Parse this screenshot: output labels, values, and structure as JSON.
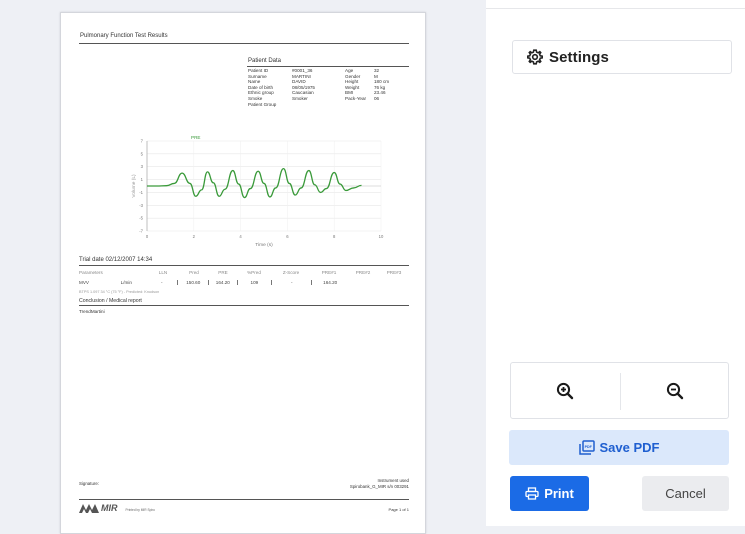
{
  "report": {
    "title": "Pulmonary Function Test Results",
    "patient_data_heading": "Patient Data",
    "patient_rows": [
      [
        "Patient ID",
        "#0001_36",
        "Age",
        "32"
      ],
      [
        "Surname",
        "MARTINI",
        "Gender",
        "M"
      ],
      [
        "Name",
        "DAVID",
        "Height",
        "180 cm"
      ],
      [
        "Date of birth",
        "08/05/1975",
        "Weight",
        "76 kg"
      ],
      [
        "Ethnic group",
        "Caucasian",
        "BMI",
        "23.46"
      ],
      [
        "Smoke",
        "Smoker",
        "Pack-Year",
        "06"
      ],
      [
        "Patient Group",
        "",
        "",
        ""
      ]
    ],
    "trial_date": "Trial date 02/12/2007 14:34",
    "param_headers": [
      "Parameters",
      "",
      "LLN",
      "Pred",
      "PRE",
      "%Pred",
      "Z-Score",
      "PRE#1",
      "PRE#2",
      "PRE#3"
    ],
    "param_rows": [
      [
        "MVV",
        "L/min",
        "-",
        "150.60",
        "164.20",
        "109",
        "-",
        "164.20",
        "",
        ""
      ]
    ],
    "btps_note": "BTPS 1.097 34 °C (75 °F) - Predicted: Knudson",
    "conclusion_heading": "Conclusion / Medical report",
    "conclusion_text": "TrendMartini",
    "signature_label": "Signature:",
    "instrument_label": "Instrument used",
    "instrument_value": "Spirobank_G_MIR s/n 003291",
    "logo_text": "MIR",
    "printed_by": "Printed by MIR Spiro",
    "page_number": "Page 1 of 1"
  },
  "chart_data": {
    "type": "line",
    "legend_label": "PRE",
    "xlabel": "Time (s)",
    "ylabel": "Volume (L)",
    "xlim": [
      0,
      10
    ],
    "ylim": [
      -7,
      7
    ],
    "x_ticks": [
      "0",
      "2",
      "4",
      "6",
      "8",
      "10"
    ],
    "y_ticks": [
      "7",
      "5",
      "3",
      "1",
      "-1",
      "-3",
      "-5",
      "-7"
    ],
    "series": [
      {
        "name": "PRE",
        "color": "#3a9a3a",
        "points": [
          [
            0.0,
            0.0
          ],
          [
            0.5,
            0.0
          ],
          [
            1.0,
            0.05
          ],
          [
            1.4,
            0.4
          ],
          [
            1.8,
            2.0
          ],
          [
            2.2,
            0.4
          ],
          [
            2.5,
            -1.6
          ],
          [
            2.8,
            -0.6
          ],
          [
            3.1,
            2.2
          ],
          [
            3.4,
            0.5
          ],
          [
            3.7,
            -1.6
          ],
          [
            4.0,
            -0.5
          ],
          [
            4.4,
            2.4
          ],
          [
            4.7,
            0.3
          ],
          [
            5.0,
            -1.8
          ],
          [
            5.3,
            -0.4
          ],
          [
            5.7,
            2.3
          ],
          [
            6.0,
            0.4
          ],
          [
            6.3,
            -1.7
          ],
          [
            6.6,
            -0.3
          ],
          [
            7.0,
            2.7
          ],
          [
            7.3,
            0.4
          ],
          [
            7.6,
            -1.4
          ],
          [
            7.9,
            -0.3
          ],
          [
            8.3,
            2.4
          ],
          [
            8.6,
            0.2
          ],
          [
            8.9,
            -1.0
          ],
          [
            9.2,
            -0.4
          ],
          [
            9.6,
            2.1
          ],
          [
            9.9,
            0.3
          ],
          [
            10.2,
            -0.7
          ],
          [
            10.6,
            -0.3
          ],
          [
            11.0,
            0.1
          ]
        ]
      }
    ]
  },
  "sidebar": {
    "settings_label": "Settings",
    "zoom_in_icon": "zoom-in-icon",
    "zoom_out_icon": "zoom-out-icon",
    "save_pdf_label": "Save PDF",
    "print_label": "Print",
    "cancel_label": "Cancel",
    "colors": {
      "primary": "#1b6be6",
      "save_pdf_bg": "#dbe8fb",
      "save_pdf_text": "#1f5fd0",
      "cancel_bg": "#ebecef"
    }
  }
}
